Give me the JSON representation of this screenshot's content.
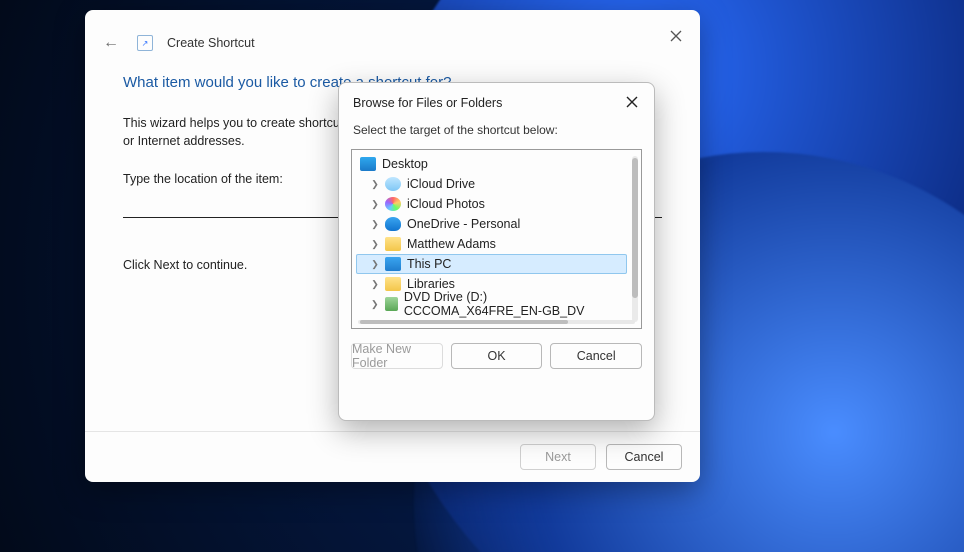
{
  "wizard": {
    "close_alt": "Close",
    "title": "Create Shortcut",
    "heading": "What item would you like to create a shortcut for?",
    "help_text": "This wizard helps you to create shortcuts to local or network programs, files, folders, computers, or Internet addresses.",
    "loc_label": "Type the location of the item:",
    "loc_value": "",
    "continue_text": "Click Next to continue.",
    "next_label": "Next",
    "cancel_label": "Cancel"
  },
  "browse": {
    "title": "Browse for Files or Folders",
    "close_alt": "Close",
    "instructions": "Select the target of the shortcut below:",
    "root": {
      "label": "Desktop",
      "icon": "i-desktop"
    },
    "items": [
      {
        "label": "iCloud Drive",
        "icon": "i-icloud",
        "selected": false
      },
      {
        "label": "iCloud Photos",
        "icon": "i-photos",
        "selected": false
      },
      {
        "label": "OneDrive - Personal",
        "icon": "i-onedrive",
        "selected": false
      },
      {
        "label": "Matthew Adams",
        "icon": "i-folder",
        "selected": false
      },
      {
        "label": "This PC",
        "icon": "i-pc",
        "selected": true
      },
      {
        "label": "Libraries",
        "icon": "i-folder",
        "selected": false
      },
      {
        "label": "DVD Drive (D:) CCCOMA_X64FRE_EN-GB_DV",
        "icon": "i-dvd",
        "selected": false
      }
    ],
    "mk_label": "Make New Folder",
    "ok_label": "OK",
    "cancel_label": "Cancel"
  }
}
